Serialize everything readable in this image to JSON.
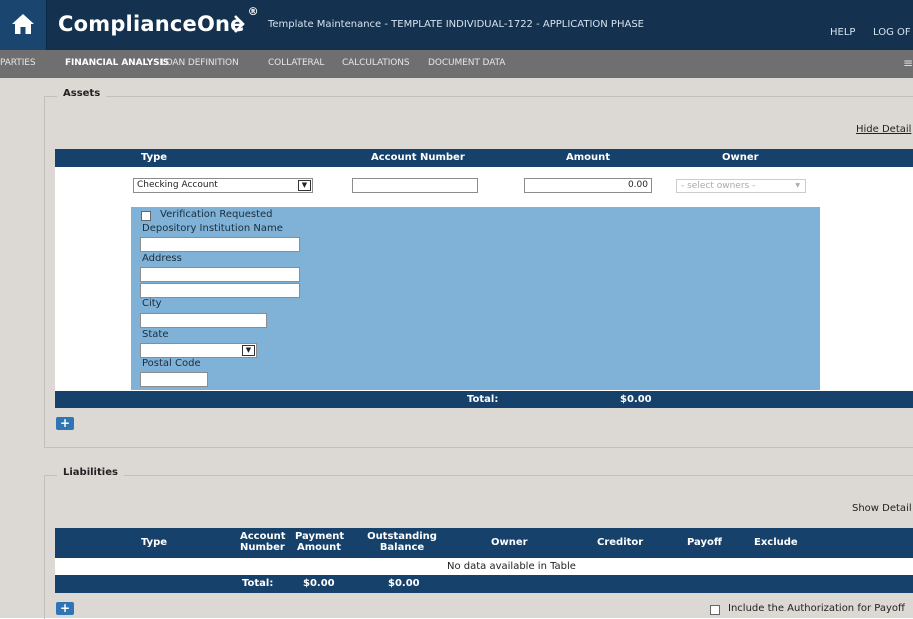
{
  "header": {
    "app_name": "ComplianceOne",
    "trademark": "®",
    "page_title": "Template Maintenance - TEMPLATE INDIVIDUAL-1722 - APPLICATION PHASE",
    "help_label": "HELP",
    "logoff_label": "LOG OF"
  },
  "menu": {
    "items": [
      "PARTIES",
      "FINANCIAL ANALYSIS",
      "LOAN DEFINITION",
      "COLLATERAL",
      "CALCULATIONS",
      "DOCUMENT DATA"
    ],
    "active": "FINANCIAL ANALYSIS"
  },
  "assets": {
    "legend": "Assets",
    "toggle_label": "Hide Detail",
    "columns": [
      "Type",
      "Account Number",
      "Amount",
      "Owner"
    ],
    "row": {
      "type": "Checking Account",
      "account_number": "",
      "amount": "0.00",
      "owner_placeholder": "- select owners -"
    },
    "detail": {
      "verification_label": "Verification Requested",
      "depository_label": "Depository Institution Name",
      "address_label": "Address",
      "city_label": "City",
      "state_label": "State",
      "postal_label": "Postal Code"
    },
    "total_label": "Total:",
    "total_value": "$0.00"
  },
  "liabilities": {
    "legend": "Liabilities",
    "toggle_label": "Show Detail",
    "columns": {
      "type": "Type",
      "account_number": [
        "Account",
        "Number"
      ],
      "payment_amount": [
        "Payment",
        "Amount"
      ],
      "outstanding_balance": [
        "Outstanding",
        "Balance"
      ],
      "owner": "Owner",
      "creditor": "Creditor",
      "payoff": "Payoff",
      "exclude": "Exclude"
    },
    "empty_message": "No data available in Table",
    "total_label": "Total:",
    "total_payment": "$0.00",
    "total_balance": "$0.00",
    "authorization_label": "Include the Authorization for Payoff"
  },
  "icons": {
    "home": "home-icon",
    "chevron": "chevron-right-icon",
    "menu": "menu-icon",
    "add": "add-icon"
  },
  "colors": {
    "header_bg": "#14324f",
    "menu_bg": "#6f6f6f",
    "table_header": "#16416a",
    "detail_panel": "#7fb2d6",
    "content_bg": "#dcd9d4"
  }
}
